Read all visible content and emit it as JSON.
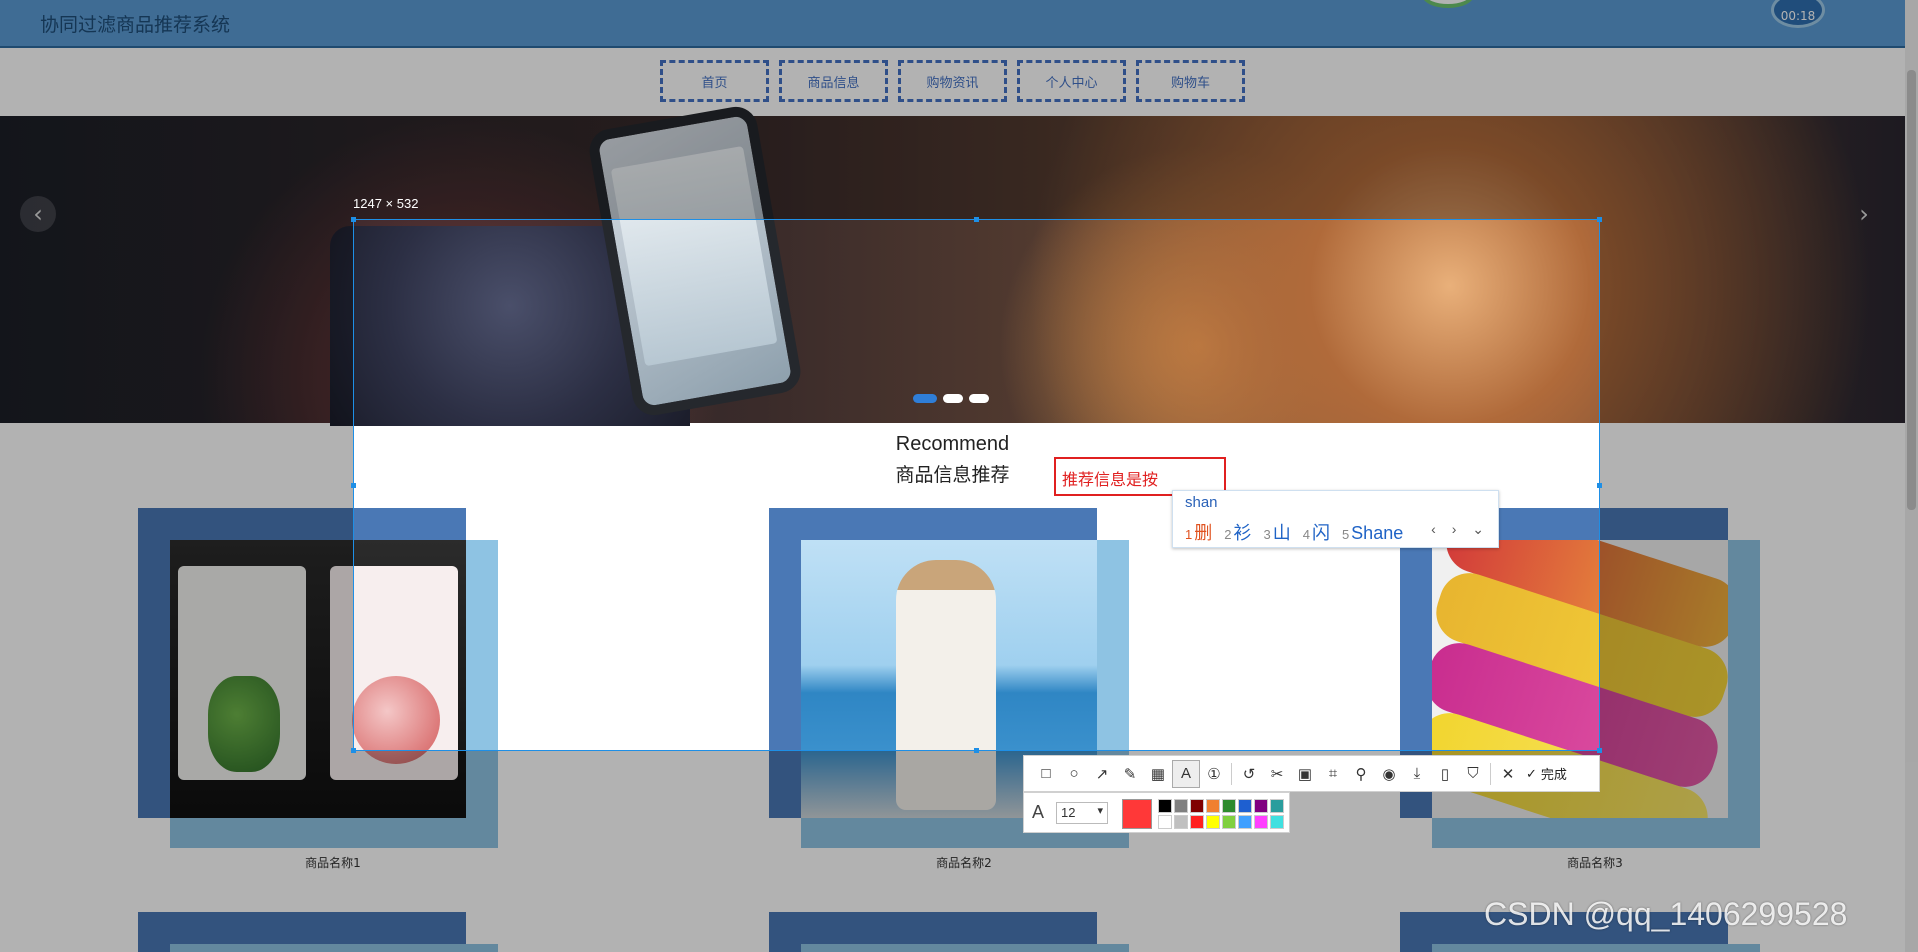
{
  "site": {
    "title": "协同过滤商品推荐系统",
    "clock_text": "00:18"
  },
  "nav": [
    {
      "label": "首页"
    },
    {
      "label": "商品信息"
    },
    {
      "label": "购物资讯"
    },
    {
      "label": "个人中心"
    },
    {
      "label": "购物车"
    }
  ],
  "banner": {
    "prev": "‹",
    "next": "›"
  },
  "recommend": {
    "title_en": "Recommend",
    "title_cn": "商品信息推荐"
  },
  "products": [
    {
      "name": "商品名称1"
    },
    {
      "name": "商品名称2"
    },
    {
      "name": "商品名称3"
    }
  ],
  "capture": {
    "size_label": "1247 × 532",
    "typed_text": "推荐信息是按",
    "ime": {
      "input": "shan",
      "candidates": [
        {
          "num": "1",
          "text": "删"
        },
        {
          "num": "2",
          "text": "衫"
        },
        {
          "num": "3",
          "text": "山"
        },
        {
          "num": "4",
          "text": "闪"
        },
        {
          "num": "5",
          "text": "Shane"
        }
      ],
      "nav": "‹ › ⌄"
    },
    "toolbar": {
      "tools": [
        {
          "name": "rect",
          "icon": "□"
        },
        {
          "name": "ellipse",
          "icon": "○"
        },
        {
          "name": "arrow",
          "icon": "↗"
        },
        {
          "name": "pen",
          "icon": "✎"
        },
        {
          "name": "mosaic",
          "icon": "▦"
        },
        {
          "name": "text",
          "icon": "A"
        },
        {
          "name": "number",
          "icon": "①"
        }
      ],
      "actions": [
        {
          "name": "undo",
          "icon": "↺"
        },
        {
          "name": "cut",
          "icon": "✂"
        },
        {
          "name": "ocr",
          "icon": "▣"
        },
        {
          "name": "scan",
          "icon": "⌗"
        },
        {
          "name": "pin",
          "icon": "⚲"
        },
        {
          "name": "record",
          "icon": "◉"
        },
        {
          "name": "download",
          "icon": "⤓"
        },
        {
          "name": "phone",
          "icon": "▯"
        },
        {
          "name": "bookmark",
          "icon": "⛉"
        }
      ],
      "close_icon": "✕",
      "done_icon": "✓",
      "done_label": "完成"
    },
    "text_settings": {
      "font_icon": "A",
      "font_size": "12",
      "font_caret": "▾",
      "current_color": "#ff3838",
      "palette": [
        "#000000",
        "#808080",
        "#800000",
        "#f08030",
        "#2e8b2e",
        "#1e5fd0",
        "#800080",
        "#2a9d9d",
        "#ffffff",
        "#c0c0c0",
        "#ff2020",
        "#ffff00",
        "#80d040",
        "#40a0ff",
        "#ff40ff",
        "#40e0e0"
      ]
    }
  },
  "watermark": "CSDN @qq_1406299528"
}
